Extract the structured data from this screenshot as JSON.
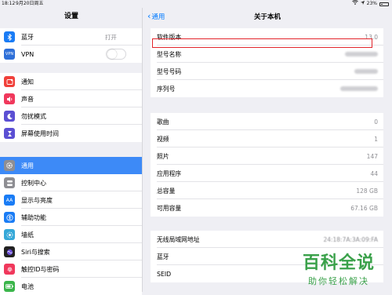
{
  "status_bar": {
    "time": "18:12",
    "date": "9月20日周五",
    "battery": "23%",
    "battery_fraction": 0.23
  },
  "sidebar": {
    "title": "设置",
    "groups": [
      [
        {
          "label": "蓝牙",
          "value": "打开",
          "icon": "bluetooth-icon",
          "color": "#1a7cf5"
        },
        {
          "label": "VPN",
          "toggle": false,
          "icon": "vpn-icon",
          "color": "#2e6fd8",
          "icon_text": "VPN"
        }
      ],
      [
        {
          "label": "通知",
          "icon": "notifications-icon",
          "color": "#f0403a"
        },
        {
          "label": "声音",
          "icon": "sound-icon",
          "color": "#f0385c"
        },
        {
          "label": "勿扰模式",
          "icon": "moon-icon",
          "color": "#5b4fd3"
        },
        {
          "label": "屏幕使用时间",
          "icon": "hourglass-icon",
          "color": "#5b4fd3"
        }
      ],
      [
        {
          "label": "通用",
          "icon": "gear-icon",
          "color": "#8e8e93",
          "selected": true
        },
        {
          "label": "控制中心",
          "icon": "control-center-icon",
          "color": "#8e8e93"
        },
        {
          "label": "显示与亮度",
          "icon": "display-icon",
          "color": "#1a7cf5",
          "icon_text": "AA"
        },
        {
          "label": "辅助功能",
          "icon": "accessibility-icon",
          "color": "#1a7cf5"
        },
        {
          "label": "墙纸",
          "icon": "wallpaper-icon",
          "color": "#35a8d8"
        },
        {
          "label": "Siri与搜索",
          "icon": "siri-icon",
          "color": "#222222"
        },
        {
          "label": "触控ID与密码",
          "icon": "fingerprint-icon",
          "color": "#f0385c"
        },
        {
          "label": "电池",
          "icon": "battery-icon",
          "color": "#3ab54a"
        }
      ]
    ]
  },
  "detail": {
    "back_label": "通用",
    "title": "关于本机",
    "group1": [
      {
        "label": "软件版本",
        "value": "13.0"
      },
      {
        "label": "型号名称",
        "value": ""
      },
      {
        "label": "型号号码",
        "value": ""
      },
      {
        "label": "序列号",
        "value": ""
      }
    ],
    "group2": [
      {
        "label": "歌曲",
        "value": "0"
      },
      {
        "label": "视频",
        "value": "1"
      },
      {
        "label": "照片",
        "value": "147"
      },
      {
        "label": "应用程序",
        "value": "44"
      },
      {
        "label": "总容量",
        "value": "128 GB"
      },
      {
        "label": "可用容量",
        "value": "67.16 GB"
      }
    ],
    "group3": [
      {
        "label": "无线局域网地址",
        "value": "24:18:7A:3A:09:FA"
      },
      {
        "label": "蓝牙",
        "value": ""
      },
      {
        "label": "SEID",
        "value": ""
      }
    ]
  },
  "watermark": {
    "big": "百科全说",
    "small": "助你轻松解决"
  }
}
